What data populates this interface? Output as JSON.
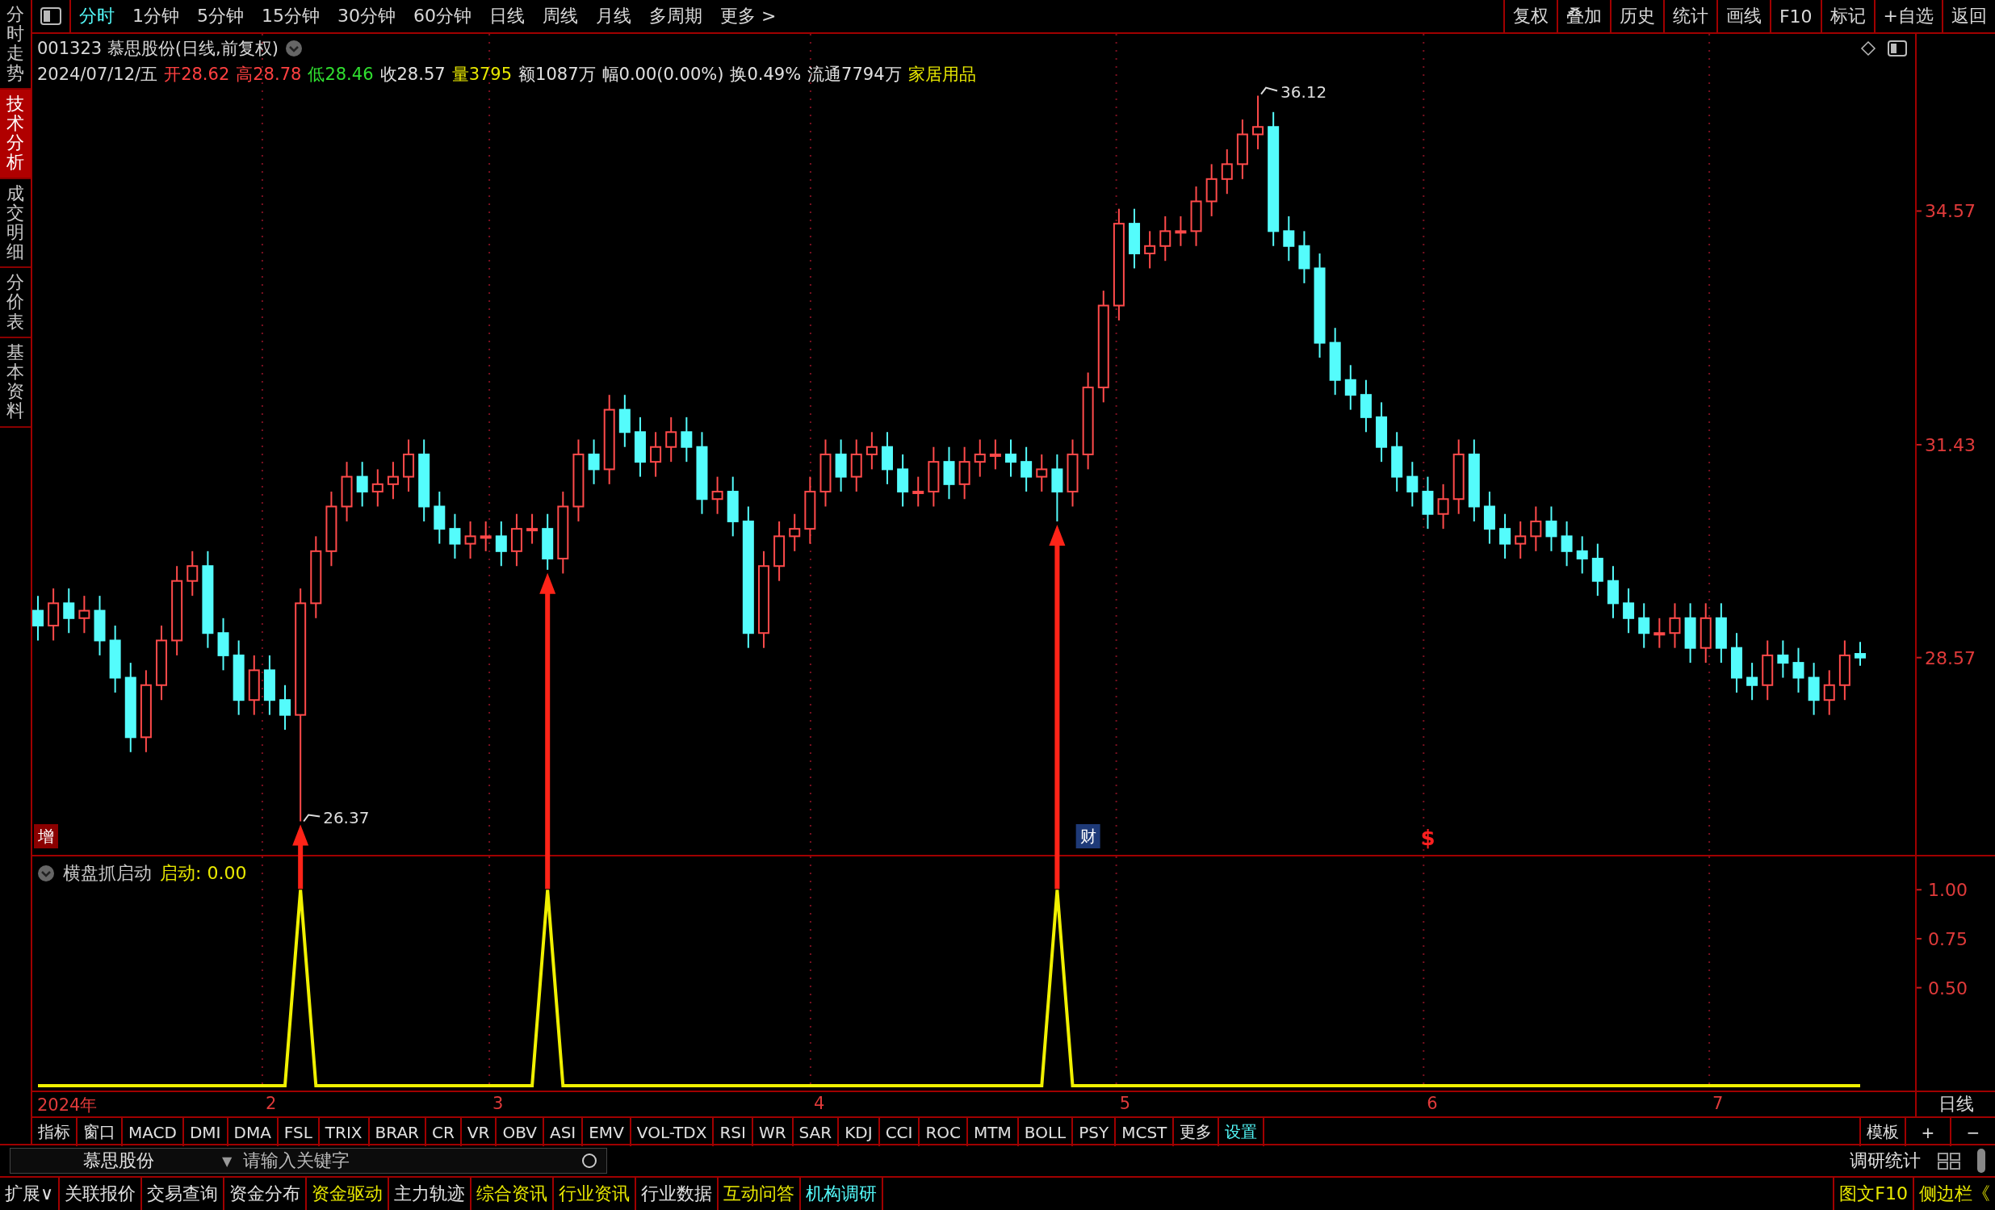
{
  "sidebar": {
    "tabs": [
      {
        "label": "分时走势",
        "selected": false
      },
      {
        "label": "技术分析",
        "selected": true
      },
      {
        "label": "成交明细",
        "selected": false
      },
      {
        "label": "分价表",
        "selected": false
      },
      {
        "label": "基本资料",
        "selected": false
      }
    ]
  },
  "period_tabs": [
    {
      "label": "分时",
      "selected": true
    },
    {
      "label": "1分钟",
      "selected": false
    },
    {
      "label": "5分钟",
      "selected": false
    },
    {
      "label": "15分钟",
      "selected": false
    },
    {
      "label": "30分钟",
      "selected": false
    },
    {
      "label": "60分钟",
      "selected": false
    },
    {
      "label": "日线",
      "selected": false
    },
    {
      "label": "周线",
      "selected": false
    },
    {
      "label": "月线",
      "selected": false
    },
    {
      "label": "多周期",
      "selected": false
    },
    {
      "label": "更多 >",
      "selected": false
    }
  ],
  "toolbar_buttons": [
    "复权",
    "叠加",
    "历史",
    "统计",
    "画线",
    "F10",
    "标记",
    "+自选",
    "返回"
  ],
  "stock": {
    "title": "001323 慕思股份(日线,前复权)",
    "date": "2024/07/12/五",
    "quotes": [
      {
        "label": "开",
        "value": "28.62",
        "color": "#ff4040"
      },
      {
        "label": "高",
        "value": "28.78",
        "color": "#ff4040"
      },
      {
        "label": "低",
        "value": "28.46",
        "color": "#30e030"
      },
      {
        "label": "收",
        "value": "28.57",
        "color": "#e0e0e0"
      },
      {
        "label": "量",
        "value": "3795",
        "color": "#e8e800"
      },
      {
        "label": "额",
        "value": "1087万",
        "color": "#e0e0e0"
      },
      {
        "label": "幅",
        "value": "0.00(0.00%)",
        "color": "#e0e0e0"
      },
      {
        "label": "换",
        "value": "0.49%",
        "color": "#e0e0e0"
      },
      {
        "label": "流通",
        "value": "7794万",
        "color": "#e0e0e0"
      }
    ],
    "industry": "家居用品"
  },
  "price_chart": {
    "high_label": "36.12",
    "low_label": "26.37",
    "markers": [
      {
        "label": "增",
        "kind": "boxed",
        "color": "#8b0000"
      },
      {
        "label": "财",
        "kind": "boxed",
        "color": "#1e3a78"
      },
      {
        "label": "$",
        "kind": "plain",
        "color": "#ff2020"
      }
    ],
    "chart_data": {
      "type": "candlestick",
      "ylim": [
        25.92,
        36.95
      ],
      "ohlc": [
        [
          29.2,
          29.4,
          28.8,
          29.0
        ],
        [
          29.0,
          29.5,
          28.8,
          29.3
        ],
        [
          29.3,
          29.5,
          28.9,
          29.1
        ],
        [
          29.1,
          29.4,
          28.9,
          29.2
        ],
        [
          29.2,
          29.4,
          28.6,
          28.8
        ],
        [
          28.8,
          29.0,
          28.1,
          28.3
        ],
        [
          28.3,
          28.5,
          27.3,
          27.5
        ],
        [
          27.5,
          28.4,
          27.3,
          28.2
        ],
        [
          28.2,
          29.0,
          28.0,
          28.8
        ],
        [
          28.8,
          29.8,
          28.6,
          29.6
        ],
        [
          29.6,
          30.0,
          29.4,
          29.8
        ],
        [
          29.8,
          30.0,
          28.7,
          28.9
        ],
        [
          28.9,
          29.1,
          28.4,
          28.6
        ],
        [
          28.6,
          28.8,
          27.8,
          28.0
        ],
        [
          28.0,
          28.6,
          27.8,
          28.4
        ],
        [
          28.4,
          28.6,
          27.8,
          28.0
        ],
        [
          28.0,
          28.2,
          27.6,
          27.8
        ],
        [
          27.8,
          29.5,
          26.37,
          29.3
        ],
        [
          29.3,
          30.2,
          29.1,
          30.0
        ],
        [
          30.0,
          30.8,
          29.8,
          30.6
        ],
        [
          30.6,
          31.2,
          30.4,
          31.0
        ],
        [
          31.0,
          31.2,
          30.6,
          30.8
        ],
        [
          30.8,
          31.1,
          30.6,
          30.9
        ],
        [
          30.9,
          31.2,
          30.7,
          31.0
        ],
        [
          31.0,
          31.5,
          30.8,
          31.3
        ],
        [
          31.3,
          31.5,
          30.4,
          30.6
        ],
        [
          30.6,
          30.8,
          30.1,
          30.3
        ],
        [
          30.3,
          30.5,
          29.9,
          30.1
        ],
        [
          30.1,
          30.4,
          29.9,
          30.2
        ],
        [
          30.2,
          30.4,
          30.0,
          30.2
        ],
        [
          30.2,
          30.4,
          29.8,
          30.0
        ],
        [
          30.0,
          30.5,
          29.8,
          30.3
        ],
        [
          30.3,
          30.5,
          30.1,
          30.3
        ],
        [
          30.3,
          30.5,
          29.75,
          29.9
        ],
        [
          29.9,
          30.8,
          29.7,
          30.6
        ],
        [
          30.6,
          31.5,
          30.4,
          31.3
        ],
        [
          31.3,
          31.5,
          30.9,
          31.1
        ],
        [
          31.1,
          32.1,
          30.9,
          31.9
        ],
        [
          31.9,
          32.1,
          31.4,
          31.6
        ],
        [
          31.6,
          31.8,
          31.0,
          31.2
        ],
        [
          31.2,
          31.6,
          31.0,
          31.4
        ],
        [
          31.4,
          31.8,
          31.2,
          31.6
        ],
        [
          31.6,
          31.8,
          31.2,
          31.4
        ],
        [
          31.4,
          31.6,
          30.5,
          30.7
        ],
        [
          30.7,
          31.0,
          30.5,
          30.8
        ],
        [
          30.8,
          31.0,
          30.2,
          30.4
        ],
        [
          30.4,
          30.6,
          28.7,
          28.9
        ],
        [
          28.9,
          30.0,
          28.7,
          29.8
        ],
        [
          29.8,
          30.4,
          29.6,
          30.2
        ],
        [
          30.2,
          30.5,
          30.0,
          30.3
        ],
        [
          30.3,
          31.0,
          30.1,
          30.8
        ],
        [
          30.8,
          31.5,
          30.6,
          31.3
        ],
        [
          31.3,
          31.5,
          30.8,
          31.0
        ],
        [
          31.0,
          31.5,
          30.8,
          31.3
        ],
        [
          31.3,
          31.6,
          31.1,
          31.4
        ],
        [
          31.4,
          31.6,
          30.9,
          31.1
        ],
        [
          31.1,
          31.3,
          30.6,
          30.8
        ],
        [
          30.8,
          31.0,
          30.6,
          30.8
        ],
        [
          30.8,
          31.4,
          30.6,
          31.2
        ],
        [
          31.2,
          31.4,
          30.7,
          30.9
        ],
        [
          30.9,
          31.4,
          30.7,
          31.2
        ],
        [
          31.2,
          31.5,
          31.0,
          31.3
        ],
        [
          31.3,
          31.5,
          31.1,
          31.3
        ],
        [
          31.3,
          31.5,
          31.0,
          31.2
        ],
        [
          31.2,
          31.4,
          30.8,
          31.0
        ],
        [
          31.0,
          31.3,
          30.8,
          31.1
        ],
        [
          31.1,
          31.3,
          30.4,
          30.8
        ],
        [
          30.8,
          31.5,
          30.6,
          31.3
        ],
        [
          31.3,
          32.4,
          31.1,
          32.2
        ],
        [
          32.2,
          33.5,
          32.0,
          33.3
        ],
        [
          33.3,
          34.6,
          33.1,
          34.4
        ],
        [
          34.4,
          34.6,
          33.8,
          34.0
        ],
        [
          34.0,
          34.3,
          33.8,
          34.1
        ],
        [
          34.1,
          34.5,
          33.9,
          34.3
        ],
        [
          34.3,
          34.5,
          34.1,
          34.3
        ],
        [
          34.3,
          34.9,
          34.1,
          34.7
        ],
        [
          34.7,
          35.2,
          34.5,
          35.0
        ],
        [
          35.0,
          35.4,
          34.8,
          35.2
        ],
        [
          35.2,
          35.8,
          35.0,
          35.6
        ],
        [
          35.6,
          36.12,
          35.4,
          35.7
        ],
        [
          35.7,
          35.9,
          34.1,
          34.3
        ],
        [
          34.3,
          34.5,
          33.9,
          34.1
        ],
        [
          34.1,
          34.3,
          33.6,
          33.8
        ],
        [
          33.8,
          34.0,
          32.6,
          32.8
        ],
        [
          32.8,
          33.0,
          32.1,
          32.3
        ],
        [
          32.3,
          32.5,
          31.9,
          32.1
        ],
        [
          32.1,
          32.3,
          31.6,
          31.8
        ],
        [
          31.8,
          32.0,
          31.2,
          31.4
        ],
        [
          31.4,
          31.6,
          30.8,
          31.0
        ],
        [
          31.0,
          31.2,
          30.6,
          30.8
        ],
        [
          30.8,
          31.0,
          30.3,
          30.5
        ],
        [
          30.5,
          30.9,
          30.3,
          30.7
        ],
        [
          30.7,
          31.5,
          30.5,
          31.3
        ],
        [
          31.3,
          31.5,
          30.4,
          30.6
        ],
        [
          30.6,
          30.8,
          30.1,
          30.3
        ],
        [
          30.3,
          30.5,
          29.9,
          30.1
        ],
        [
          30.1,
          30.4,
          29.9,
          30.2
        ],
        [
          30.2,
          30.6,
          30.0,
          30.4
        ],
        [
          30.4,
          30.6,
          30.0,
          30.2
        ],
        [
          30.2,
          30.4,
          29.8,
          30.0
        ],
        [
          30.0,
          30.2,
          29.7,
          29.9
        ],
        [
          29.9,
          30.1,
          29.4,
          29.6
        ],
        [
          29.6,
          29.8,
          29.1,
          29.3
        ],
        [
          29.3,
          29.5,
          28.9,
          29.1
        ],
        [
          29.1,
          29.3,
          28.7,
          28.9
        ],
        [
          28.9,
          29.1,
          28.7,
          28.9
        ],
        [
          28.9,
          29.3,
          28.7,
          29.1
        ],
        [
          29.1,
          29.3,
          28.5,
          28.7
        ],
        [
          28.7,
          29.3,
          28.5,
          29.1
        ],
        [
          29.1,
          29.3,
          28.5,
          28.7
        ],
        [
          28.7,
          28.9,
          28.1,
          28.3
        ],
        [
          28.3,
          28.5,
          28.0,
          28.2
        ],
        [
          28.2,
          28.8,
          28.0,
          28.6
        ],
        [
          28.6,
          28.8,
          28.3,
          28.5
        ],
        [
          28.5,
          28.7,
          28.1,
          28.3
        ],
        [
          28.3,
          28.5,
          27.8,
          28.0
        ],
        [
          28.0,
          28.4,
          27.8,
          28.2
        ],
        [
          28.2,
          28.8,
          28.0,
          28.6
        ],
        [
          28.62,
          28.78,
          28.46,
          28.57
        ]
      ],
      "yticks": [
        {
          "value": 34.57,
          "label": "34.57"
        },
        {
          "value": 31.43,
          "label": "31.43"
        },
        {
          "value": 28.57,
          "label": "28.57"
        }
      ]
    }
  },
  "indicator": {
    "name": "横盘抓启动",
    "reading": "启动: 0.00",
    "chart_data": {
      "type": "line",
      "ylim": [
        -0.025,
        1.17
      ],
      "yticks": [
        {
          "value": 0.5,
          "label": "0.50"
        },
        {
          "value": 0.75,
          "label": "0.75"
        },
        {
          "value": 1,
          "label": "1.00"
        }
      ],
      "series": [
        {
          "color": "#f0f000",
          "values": [
            0,
            0,
            0,
            0,
            0,
            0,
            0,
            0,
            0,
            0,
            0,
            0,
            0,
            0,
            0,
            0,
            0,
            1,
            0,
            0,
            0,
            0,
            0,
            0,
            0,
            0,
            0,
            0,
            0,
            0,
            0,
            0,
            0,
            1,
            0,
            0,
            0,
            0,
            0,
            0,
            0,
            0,
            0,
            0,
            0,
            0,
            0,
            0,
            0,
            0,
            0,
            0,
            0,
            0,
            0,
            0,
            0,
            0,
            0,
            0,
            0,
            0,
            0,
            0,
            0,
            0,
            1,
            0,
            0,
            0,
            0,
            0,
            0,
            0,
            0,
            0,
            0,
            0,
            0,
            0,
            0,
            0,
            0,
            0,
            0,
            0,
            0,
            0,
            0,
            0,
            0,
            0,
            0,
            0,
            0,
            0,
            0,
            0,
            0,
            0,
            0,
            0,
            0,
            0,
            0,
            0,
            0,
            0,
            0,
            0,
            0,
            0,
            0,
            0,
            0,
            0,
            0,
            0,
            0
          ]
        }
      ]
    }
  },
  "date_axis": [
    "2024年",
    "2",
    "3",
    "4",
    "5",
    "6",
    "7"
  ],
  "period_label": "日线",
  "indicator_tabs": [
    {
      "label": "指标",
      "kind": "plain"
    },
    {
      "label": "窗口",
      "kind": "plain"
    },
    {
      "label": "MACD",
      "kind": "plain"
    },
    {
      "label": "DMI",
      "kind": "plain"
    },
    {
      "label": "DMA",
      "kind": "plain"
    },
    {
      "label": "FSL",
      "kind": "plain"
    },
    {
      "label": "TRIX",
      "kind": "plain"
    },
    {
      "label": "BRAR",
      "kind": "plain"
    },
    {
      "label": "CR",
      "kind": "plain"
    },
    {
      "label": "VR",
      "kind": "plain"
    },
    {
      "label": "OBV",
      "kind": "plain"
    },
    {
      "label": "ASI",
      "kind": "plain"
    },
    {
      "label": "EMV",
      "kind": "plain"
    },
    {
      "label": "VOL-TDX",
      "kind": "plain"
    },
    {
      "label": "RSI",
      "kind": "plain"
    },
    {
      "label": "WR",
      "kind": "plain"
    },
    {
      "label": "SAR",
      "kind": "plain"
    },
    {
      "label": "KDJ",
      "kind": "plain"
    },
    {
      "label": "CCI",
      "kind": "plain"
    },
    {
      "label": "ROC",
      "kind": "plain"
    },
    {
      "label": "MTM",
      "kind": "plain"
    },
    {
      "label": "BOLL",
      "kind": "plain"
    },
    {
      "label": "PSY",
      "kind": "plain"
    },
    {
      "label": "MCST",
      "kind": "plain"
    },
    {
      "label": "更多",
      "kind": "plain"
    },
    {
      "label": "设置",
      "kind": "special"
    }
  ],
  "panel_buttons": [
    "模板",
    "+",
    "−"
  ],
  "search": {
    "stock": "慕思股份",
    "dropdown": "▼",
    "placeholder": "请输入关键字",
    "stats_label": "调研统计"
  },
  "bottom_tabs": [
    {
      "label": "扩展∨",
      "kind": "plain"
    },
    {
      "label": "关联报价",
      "kind": "plain"
    },
    {
      "label": "交易查询",
      "kind": "plain"
    },
    {
      "label": "资金分布",
      "kind": "plain"
    },
    {
      "label": "资金驱动",
      "kind": "featured"
    },
    {
      "label": "主力轨迹",
      "kind": "plain"
    },
    {
      "label": "综合资讯",
      "kind": "featured"
    },
    {
      "label": "行业资讯",
      "kind": "featured"
    },
    {
      "label": "行业数据",
      "kind": "plain"
    },
    {
      "label": "互动问答",
      "kind": "featured"
    },
    {
      "label": "机构调研",
      "kind": "special"
    }
  ],
  "bottom_right": [
    "图文F10",
    "侧边栏《"
  ]
}
